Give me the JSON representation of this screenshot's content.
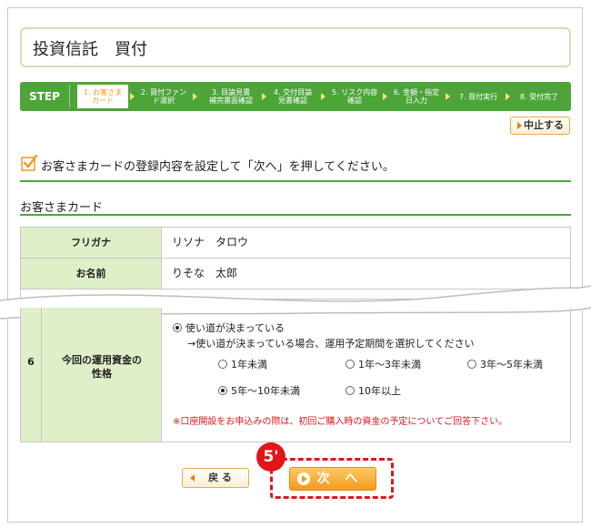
{
  "page_title": "投資信託　買付",
  "stepbar": {
    "label": "STEP",
    "steps": [
      {
        "label": "1. お客さま\nカード",
        "active": true
      },
      {
        "label": "2. 買付ファン\nド選択",
        "active": false
      },
      {
        "label": "3. 目論見書\n補完書面確認",
        "active": false
      },
      {
        "label": "4. 交付目論\n見書確認",
        "active": false
      },
      {
        "label": "5. リスク内容\n確認",
        "active": false
      },
      {
        "label": "6. 金額・指定\n日入力",
        "active": false
      },
      {
        "label": "7. 買付実行",
        "active": false
      },
      {
        "label": "8. 受付完了",
        "active": false
      }
    ]
  },
  "cancel_label": "中止する",
  "instruction": "お客さまカードの登録内容を設定して「次へ」を押してください。",
  "section_title": "お客さまカード",
  "rows": [
    {
      "label": "フリガナ",
      "value": "リソナ　タロウ"
    },
    {
      "label": "お名前",
      "value": "りそな　太郎"
    }
  ],
  "question": {
    "number": "6",
    "label": "今回の運用資金の\n性格",
    "main_option": "使い道が決まっている",
    "sub_text": "→使い道が決まっている場合、運用予定期間を選択してください",
    "periods": [
      {
        "label": "1年未満",
        "selected": false
      },
      {
        "label": "1年〜3年未満",
        "selected": false
      },
      {
        "label": "3年〜5年未満",
        "selected": false
      },
      {
        "label": "5年〜10年未満",
        "selected": true
      },
      {
        "label": "10年以上",
        "selected": false
      }
    ],
    "note": "※口座開設をお申込みの際は、初回ご購入時の資金の予定についてご回答下さい。"
  },
  "back_label": "戻 る",
  "next_label": "次 へ",
  "step_marker": "5'"
}
